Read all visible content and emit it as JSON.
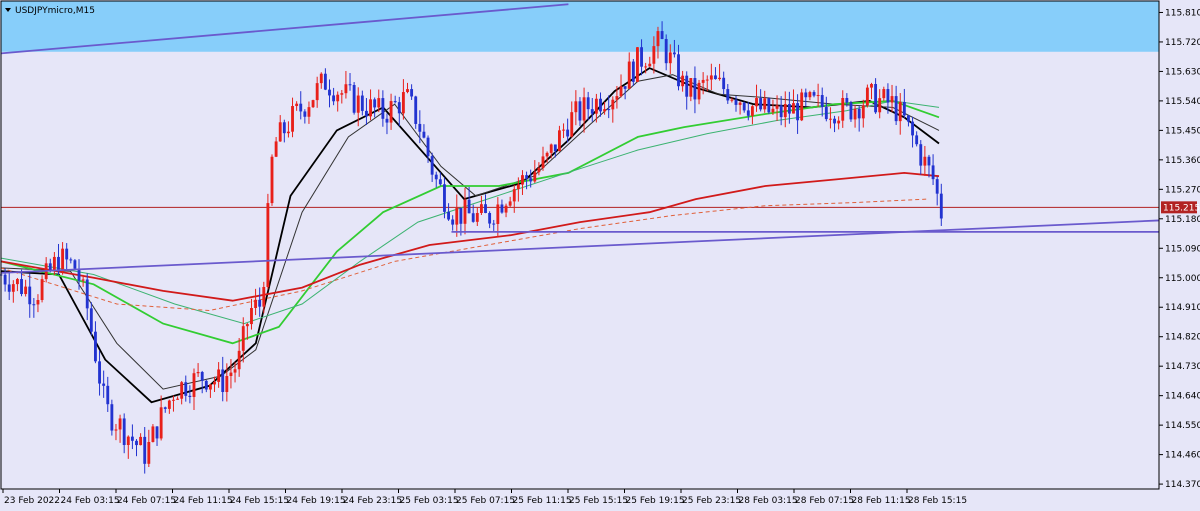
{
  "chart_data": {
    "type": "candlestick",
    "symbol_label": "USDJPYmicro,M15",
    "current_price_label": "115.215",
    "current_price": 115.215,
    "y_ticks": [
      "115.810",
      "115.720",
      "115.630",
      "115.540",
      "115.450",
      "115.360",
      "115.270",
      "115.180",
      "115.090",
      "115.000",
      "114.910",
      "114.820",
      "114.730",
      "114.640",
      "114.550",
      "114.460",
      "114.370"
    ],
    "y_tick_values": [
      115.81,
      115.72,
      115.63,
      115.54,
      115.45,
      115.36,
      115.27,
      115.18,
      115.09,
      115.0,
      114.91,
      114.82,
      114.73,
      114.64,
      114.55,
      114.46,
      114.37
    ],
    "ylim": [
      114.355,
      115.845
    ],
    "x_ticks": [
      "23 Feb 2022",
      "24 Feb 03:15",
      "24 Feb 07:15",
      "24 Feb 11:15",
      "24 Feb 15:15",
      "24 Feb 19:15",
      "24 Feb 23:15",
      "25 Feb 03:15",
      "25 Feb 07:15",
      "25 Feb 11:15",
      "25 Feb 15:15",
      "25 Feb 19:15",
      "25 Feb 23:15",
      "28 Feb 03:15",
      "28 Feb 07:15",
      "28 Feb 11:15",
      "28 Feb 15:15"
    ],
    "grid": false,
    "zones": [
      {
        "name": "resistance-zone",
        "from": 115.845,
        "to": 115.69,
        "color": "#87cefa"
      }
    ],
    "horizontal_lines": [
      {
        "name": "price-line",
        "value": 115.215,
        "color": "#b22222"
      }
    ],
    "trendlines": [
      {
        "name": "upper-trendline",
        "x_start": 0,
        "y_start": 115.685,
        "x_end": 0.49,
        "y_end": 115.835,
        "color": "#6a5acd"
      },
      {
        "name": "lower-trendline",
        "x_start": 0,
        "y_start": 115.015,
        "x_end": 1.0,
        "y_end": 115.175,
        "color": "#6a5acd"
      },
      {
        "name": "support-line",
        "x_start": 0.389,
        "y_start": 115.14,
        "x_end": 1.0,
        "y_end": 115.14,
        "color": "#6a5acd"
      }
    ],
    "price_path": [
      [
        0,
        115.01
      ],
      [
        0.03,
        114.95
      ],
      [
        0.05,
        115.06
      ],
      [
        0.065,
        115.03
      ],
      [
        0.075,
        114.9
      ],
      [
        0.09,
        114.6
      ],
      [
        0.11,
        114.52
      ],
      [
        0.125,
        114.46
      ],
      [
        0.135,
        114.55
      ],
      [
        0.15,
        114.66
      ],
      [
        0.175,
        114.7
      ],
      [
        0.19,
        114.68
      ],
      [
        0.205,
        114.74
      ],
      [
        0.215,
        114.9
      ],
      [
        0.225,
        114.92
      ],
      [
        0.235,
        115.4
      ],
      [
        0.25,
        115.48
      ],
      [
        0.28,
        115.6
      ],
      [
        0.3,
        115.55
      ],
      [
        0.33,
        115.5
      ],
      [
        0.35,
        115.55
      ],
      [
        0.36,
        115.48
      ],
      [
        0.375,
        115.3
      ],
      [
        0.39,
        115.2
      ],
      [
        0.42,
        115.18
      ],
      [
        0.44,
        115.27
      ],
      [
        0.47,
        115.35
      ],
      [
        0.49,
        115.48
      ],
      [
        0.51,
        115.53
      ],
      [
        0.53,
        115.57
      ],
      [
        0.55,
        115.66
      ],
      [
        0.57,
        115.72
      ],
      [
        0.59,
        115.58
      ],
      [
        0.6,
        115.56
      ],
      [
        0.61,
        115.6
      ],
      [
        0.63,
        115.57
      ],
      [
        0.65,
        115.52
      ],
      [
        0.67,
        115.5
      ],
      [
        0.7,
        115.53
      ],
      [
        0.73,
        115.51
      ],
      [
        0.75,
        115.55
      ],
      [
        0.77,
        115.53
      ],
      [
        0.78,
        115.48
      ],
      [
        0.795,
        115.37
      ],
      [
        0.805,
        115.3
      ],
      [
        0.812,
        115.2
      ]
    ],
    "series": [
      {
        "values": [
          [
            0,
            115.02
          ],
          [
            0.05,
            115.01
          ],
          [
            0.09,
            114.75
          ],
          [
            0.13,
            114.62
          ],
          [
            0.18,
            114.67
          ],
          [
            0.22,
            114.8
          ],
          [
            0.25,
            115.25
          ],
          [
            0.29,
            115.45
          ],
          [
            0.33,
            115.52
          ],
          [
            0.37,
            115.36
          ],
          [
            0.4,
            115.24
          ],
          [
            0.45,
            115.29
          ],
          [
            0.49,
            115.42
          ],
          [
            0.53,
            115.57
          ],
          [
            0.56,
            115.64
          ],
          [
            0.6,
            115.58
          ],
          [
            0.65,
            115.53
          ],
          [
            0.7,
            115.52
          ],
          [
            0.75,
            115.54
          ],
          [
            0.78,
            115.49
          ],
          [
            0.81,
            115.41
          ]
        ],
        "color": "#000000"
      },
      {
        "values": [
          [
            0,
            115.03
          ],
          [
            0.06,
            115.02
          ],
          [
            0.1,
            114.8
          ],
          [
            0.14,
            114.66
          ],
          [
            0.19,
            114.7
          ],
          [
            0.22,
            114.78
          ],
          [
            0.26,
            115.2
          ],
          [
            0.3,
            115.43
          ],
          [
            0.34,
            115.53
          ],
          [
            0.38,
            115.34
          ],
          [
            0.41,
            115.25
          ],
          [
            0.46,
            115.31
          ],
          [
            0.5,
            115.44
          ],
          [
            0.55,
            115.6
          ],
          [
            0.58,
            115.62
          ],
          [
            0.62,
            115.56
          ],
          [
            0.66,
            115.55
          ],
          [
            0.72,
            115.53
          ],
          [
            0.77,
            115.52
          ],
          [
            0.81,
            115.45
          ]
        ],
        "color": "#333333"
      },
      {
        "values": [
          [
            0,
            115.05
          ],
          [
            0.08,
            114.98
          ],
          [
            0.14,
            114.86
          ],
          [
            0.2,
            114.8
          ],
          [
            0.24,
            114.85
          ],
          [
            0.29,
            115.08
          ],
          [
            0.33,
            115.2
          ],
          [
            0.38,
            115.28
          ],
          [
            0.43,
            115.28
          ],
          [
            0.49,
            115.32
          ],
          [
            0.55,
            115.43
          ],
          [
            0.59,
            115.46
          ],
          [
            0.66,
            115.5
          ],
          [
            0.72,
            115.53
          ],
          [
            0.77,
            115.54
          ],
          [
            0.81,
            115.49
          ]
        ],
        "color": "#32cd32"
      },
      {
        "values": [
          [
            0,
            115.06
          ],
          [
            0.08,
            115.01
          ],
          [
            0.15,
            114.92
          ],
          [
            0.21,
            114.86
          ],
          [
            0.26,
            114.92
          ],
          [
            0.31,
            115.05
          ],
          [
            0.36,
            115.17
          ],
          [
            0.42,
            115.24
          ],
          [
            0.48,
            115.31
          ],
          [
            0.55,
            115.39
          ],
          [
            0.61,
            115.44
          ],
          [
            0.67,
            115.48
          ],
          [
            0.73,
            115.51
          ],
          [
            0.77,
            115.54
          ],
          [
            0.81,
            115.52
          ]
        ],
        "color": "#3cb371"
      },
      {
        "values": [
          [
            0,
            115.05
          ],
          [
            0.08,
            115.0
          ],
          [
            0.14,
            114.96
          ],
          [
            0.2,
            114.93
          ],
          [
            0.26,
            114.97
          ],
          [
            0.31,
            115.04
          ],
          [
            0.37,
            115.1
          ],
          [
            0.44,
            115.13
          ],
          [
            0.5,
            115.17
          ],
          [
            0.56,
            115.2
          ],
          [
            0.6,
            115.24
          ],
          [
            0.66,
            115.28
          ],
          [
            0.72,
            115.3
          ],
          [
            0.78,
            115.32
          ],
          [
            0.81,
            115.31
          ]
        ],
        "color": "#d11a1a"
      },
      {
        "values": [
          [
            0,
            115.03
          ],
          [
            0.1,
            114.92
          ],
          [
            0.18,
            114.9
          ],
          [
            0.26,
            114.96
          ],
          [
            0.34,
            115.05
          ],
          [
            0.42,
            115.1
          ],
          [
            0.5,
            115.15
          ],
          [
            0.58,
            115.19
          ],
          [
            0.66,
            115.22
          ],
          [
            0.74,
            115.23
          ],
          [
            0.8,
            115.24
          ]
        ],
        "color": "#e0603a"
      }
    ]
  }
}
